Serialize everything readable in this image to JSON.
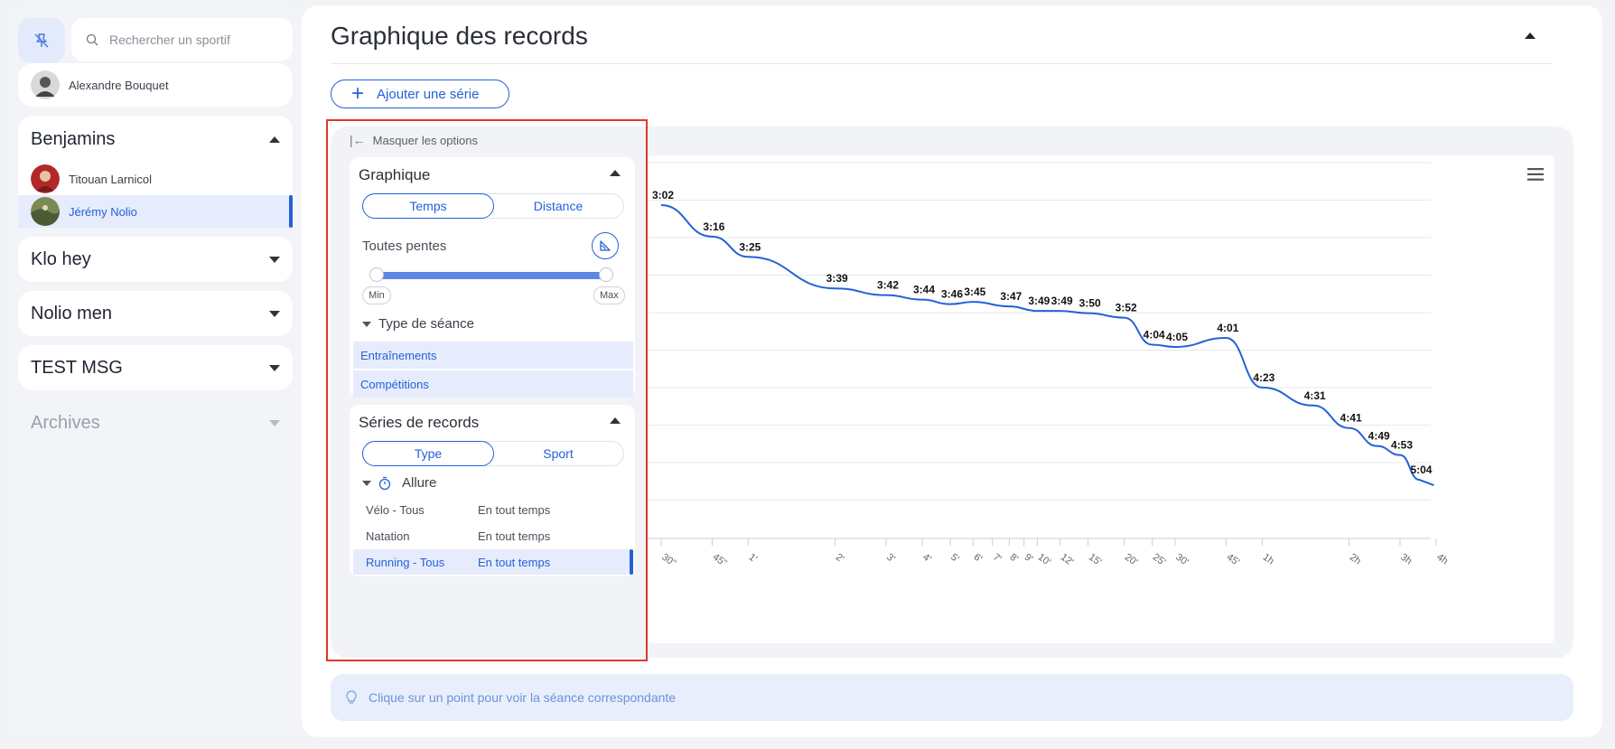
{
  "sidebar": {
    "search_placeholder": "Rechercher un sportif",
    "current_user": "Alexandre Bouquet",
    "groups": [
      {
        "title": "Benjamins",
        "expanded": true,
        "members": [
          {
            "name": "Titouan Larnicol",
            "active": false
          },
          {
            "name": "Jérémy Nolio",
            "active": true
          }
        ]
      },
      {
        "title": "Klo hey",
        "expanded": false
      },
      {
        "title": "Nolio men",
        "expanded": false
      },
      {
        "title": "TEST MSG",
        "expanded": false
      }
    ],
    "archives": "Archives"
  },
  "main": {
    "title": "Graphique des records",
    "add_series": "Ajouter une série",
    "hint": "Clique sur un point pour voir la séance correspondante"
  },
  "options": {
    "hide_label": "Masquer les options",
    "graph": {
      "title": "Graphique",
      "toggle": [
        "Temps",
        "Distance"
      ],
      "toggle_selected": "Temps",
      "slope_label": "Toutes pentes",
      "slider_min": "Min",
      "slider_max": "Max",
      "session_type_title": "Type de séance",
      "session_types": [
        "Entraînements",
        "Compétitions"
      ]
    },
    "series": {
      "title": "Séries de records",
      "toggle": [
        "Type",
        "Sport"
      ],
      "toggle_selected": "Type",
      "group_title": "Allure",
      "rows": [
        {
          "sport": "Vélo - Tous",
          "period": "En tout temps",
          "active": false
        },
        {
          "sport": "Natation",
          "period": "En tout temps",
          "active": false
        },
        {
          "sport": "Running - Tous",
          "period": "En tout temps",
          "active": true
        }
      ]
    }
  },
  "colors": {
    "accent": "#2461d8",
    "line": "#2461d8",
    "highlight_border": "#e0362b"
  },
  "chart_data": {
    "type": "line",
    "x_ticks": [
      "30\"",
      "45\"",
      "1'",
      "2'",
      "3'",
      "4'",
      "5'",
      "6'",
      "7'",
      "8'",
      "9'",
      "10'",
      "12'",
      "15'",
      "20'",
      "25'",
      "30'",
      "45'",
      "1h",
      "2h",
      "3h",
      "4h"
    ],
    "x_scale": "log",
    "series": [
      {
        "points": [
          {
            "x": "30\"",
            "label": "3:02"
          },
          {
            "x": "45\"",
            "label": "3:16"
          },
          {
            "x": "1'",
            "label": "3:25"
          },
          {
            "x": "2'",
            "label": "3:39"
          },
          {
            "x": "3'",
            "label": "3:42"
          },
          {
            "x": "4'",
            "label": "3:44"
          },
          {
            "x": "5'",
            "label": "3:46"
          },
          {
            "x": "6'",
            "label": "3:45"
          },
          {
            "x": "8'",
            "label": "3:47"
          },
          {
            "x": "10'",
            "label": "3:49"
          },
          {
            "x": "12'",
            "label": "3:49"
          },
          {
            "x": "15'",
            "label": "3:50"
          },
          {
            "x": "20'",
            "label": "3:52"
          },
          {
            "x": "25'",
            "label": "4:04"
          },
          {
            "x": "30'",
            "label": "4:05"
          },
          {
            "x": "45'",
            "label": "4:01"
          },
          {
            "x": "1h",
            "label": "4:23"
          },
          {
            "x": "1h30",
            "label": "4:31"
          },
          {
            "x": "2h",
            "label": "4:41"
          },
          {
            "x": "2h30",
            "label": "4:49"
          },
          {
            "x": "3h",
            "label": "4:53"
          },
          {
            "x": "3h30",
            "label": "5:04"
          }
        ]
      }
    ],
    "grid": true,
    "legend": "none"
  }
}
